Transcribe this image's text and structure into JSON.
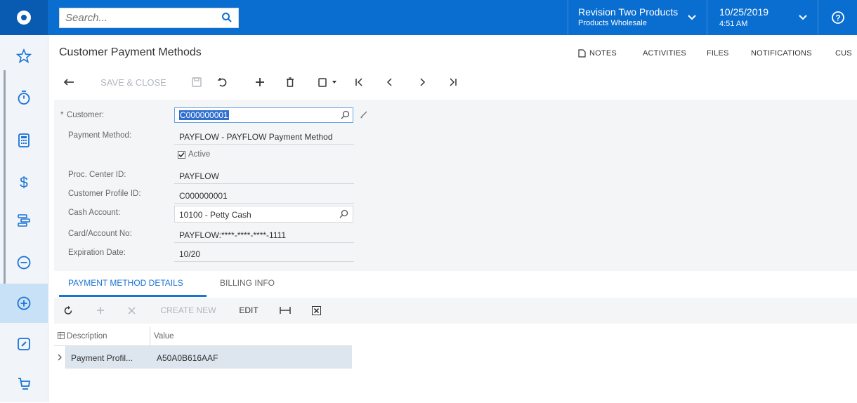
{
  "search": {
    "placeholder": "Search..."
  },
  "company": {
    "name": "Revision Two Products",
    "branch": "Products Wholesale"
  },
  "datetime": {
    "date": "10/25/2019",
    "time": "4:51 AM"
  },
  "page": {
    "title": "Customer Payment Methods"
  },
  "header_links": {
    "notes": "NOTES",
    "activities": "ACTIVITIES",
    "files": "FILES",
    "notifications": "NOTIFICATIONS",
    "customization": "CUS"
  },
  "toolbar": {
    "save_close": "SAVE & CLOSE"
  },
  "form": {
    "required_mark": "*",
    "customer_label": "Customer:",
    "customer_value": "C000000001",
    "payment_method_label": "Payment Method:",
    "payment_method_value": "PAYFLOW - PAYFLOW Payment Method",
    "active_label": "Active",
    "proc_center_label": "Proc. Center ID:",
    "proc_center_value": "PAYFLOW",
    "customer_profile_label": "Customer Profile ID:",
    "customer_profile_value": "C000000001",
    "cash_account_label": "Cash Account:",
    "cash_account_value": "10100 - Petty Cash",
    "card_label": "Card/Account No:",
    "card_value": "PAYFLOW:****-****-****-1111",
    "expiration_label": "Expiration Date:",
    "expiration_value": "10/20"
  },
  "tabs": {
    "details": "PAYMENT METHOD DETAILS",
    "billing": "BILLING INFO"
  },
  "grid_toolbar": {
    "create_new": "CREATE NEW",
    "edit": "EDIT"
  },
  "table": {
    "columns": [
      "Description",
      "Value"
    ],
    "rows": [
      {
        "description": "Payment Profil...",
        "value": "A50A0B616AAF"
      }
    ]
  },
  "colors": {
    "brand": "#0a6ed1",
    "accent": "#1a73d6",
    "nav_active": "#c9e1f7",
    "row_selected": "#dde6ef"
  }
}
